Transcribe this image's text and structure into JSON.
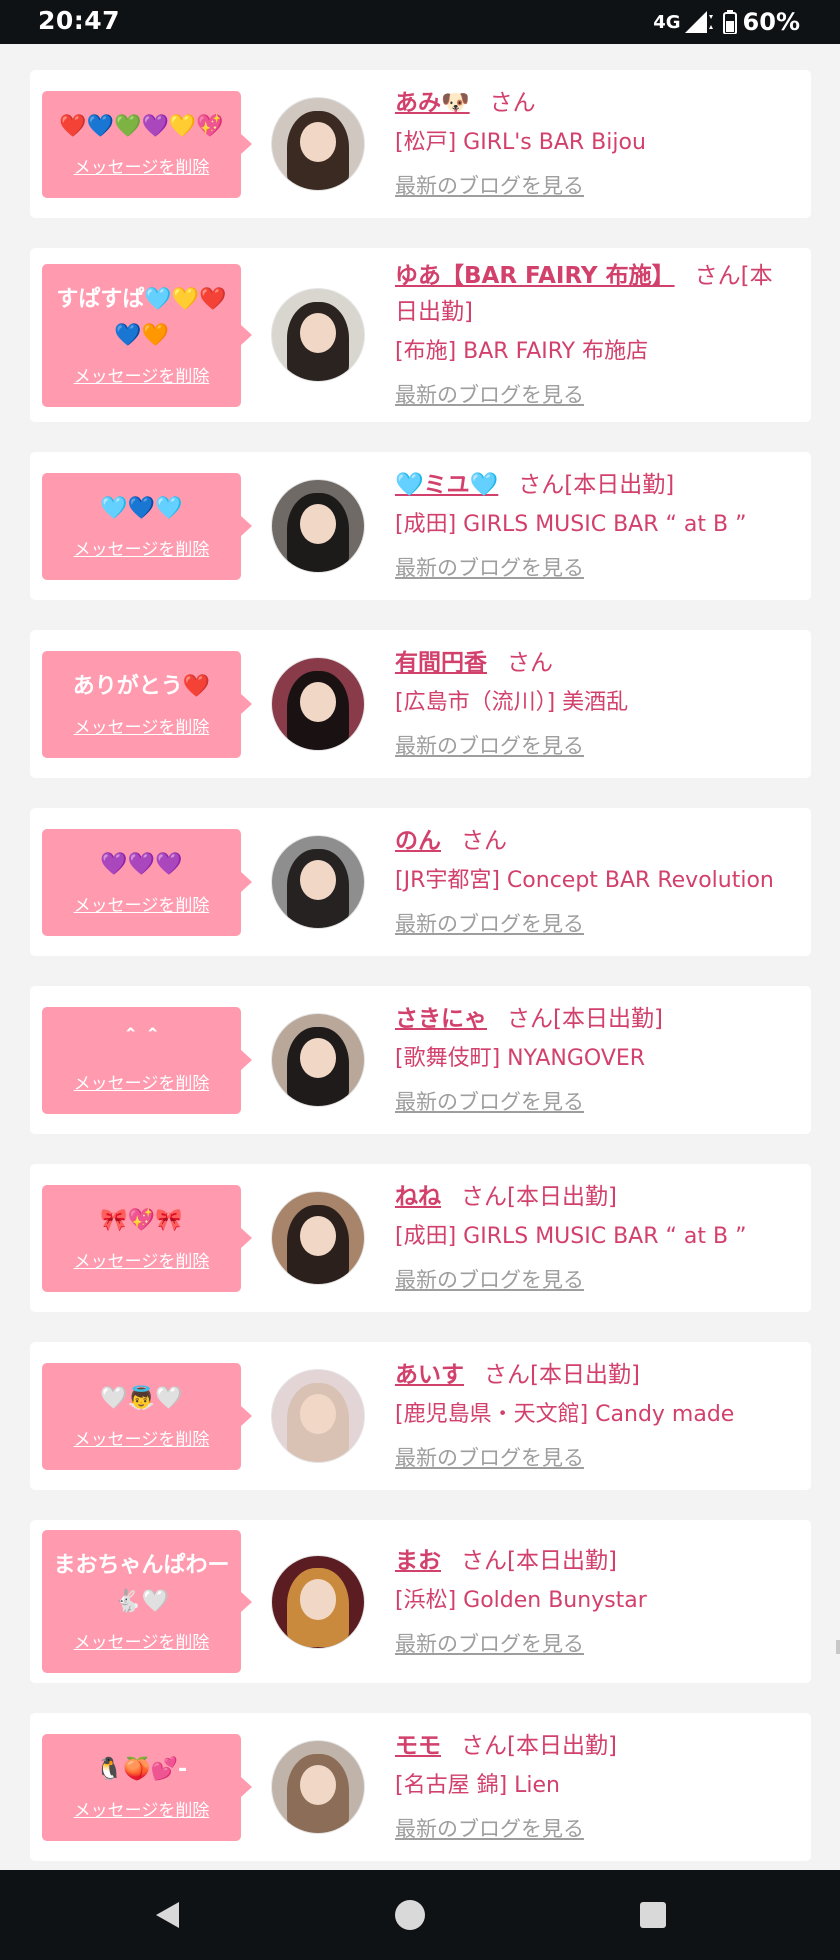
{
  "status_bar": {
    "time": "20:47",
    "network": "4G",
    "battery": "60%"
  },
  "delete_label": "メッセージを削除",
  "blog_label": "最新のブログを見る",
  "colors": {
    "accent": "#d2406c",
    "bubble": "#ff9aaf",
    "link_gray": "#9e9e9e",
    "background": "#f3f3f3"
  },
  "items": [
    {
      "message": "❤️💙💚💜💛💖",
      "name": "あみ🐶",
      "suffix": "さん",
      "shop": "[松戸] GIRL's BAR Bijou",
      "avatar": {
        "bg": "#cfc7c0",
        "hair": "#3b2a22"
      }
    },
    {
      "message": "すぱすぱ🩵💛❤️💙🧡",
      "name": "ゆあ【BAR FAIRY 布施】",
      "suffix": "さん[本日出勤]",
      "shop": "[布施] BAR FAIRY 布施店",
      "avatar": {
        "bg": "#d9d6cf",
        "hair": "#2a2320"
      }
    },
    {
      "message": "🩵💙🩵",
      "name": "🩵ミユ🩵",
      "suffix": "さん[本日出勤]",
      "shop": "[成田] GIRLS MUSIC BAR “ at B ”",
      "avatar": {
        "bg": "#6f6a66",
        "hair": "#1d1a1a"
      }
    },
    {
      "message": "ありがとう❤️",
      "name": "有間円香",
      "suffix": "さん",
      "shop": "[広島市（流川）] 美酒乱",
      "avatar": {
        "bg": "#8a3b4a",
        "hair": "#1a1212"
      }
    },
    {
      "message": "💜💜💜",
      "name": "のん",
      "suffix": "さん",
      "shop": "[JR宇都宮] Concept BAR Revolution",
      "avatar": {
        "bg": "#8e8e8e",
        "hair": "#262222"
      }
    },
    {
      "message": "＾＾",
      "name": "さきにゃ",
      "suffix": "さん[本日出勤]",
      "shop": "[歌舞伎町] NYANGOVER",
      "avatar": {
        "bg": "#b9a79a",
        "hair": "#1f1b1a"
      }
    },
    {
      "message": "🎀💖🎀",
      "name": "ねね",
      "suffix": "さん[本日出勤]",
      "shop": "[成田] GIRLS MUSIC BAR “ at B ”",
      "avatar": {
        "bg": "#a8846a",
        "hair": "#2b201b"
      }
    },
    {
      "message": "🤍👼🤍",
      "name": "あいす",
      "suffix": "さん[本日出勤]",
      "shop": "[鹿児島県・天文館] Candy made",
      "avatar": {
        "bg": "#e3d4d6",
        "hair": "#d9c2b4"
      }
    },
    {
      "message": "まおちゃんぱわー🐇🤍",
      "name": "まお",
      "suffix": "さん[本日出勤]",
      "shop": "[浜松] Golden Bunystar",
      "avatar": {
        "bg": "#5c1d22",
        "hair": "#c98a3d"
      }
    },
    {
      "message": "🐧🍑💕-",
      "name": "モモ",
      "suffix": "さん[本日出勤]",
      "shop": "[名古屋 錦] Lien",
      "avatar": {
        "bg": "#bfb3aa",
        "hair": "#8c6d57"
      }
    }
  ]
}
